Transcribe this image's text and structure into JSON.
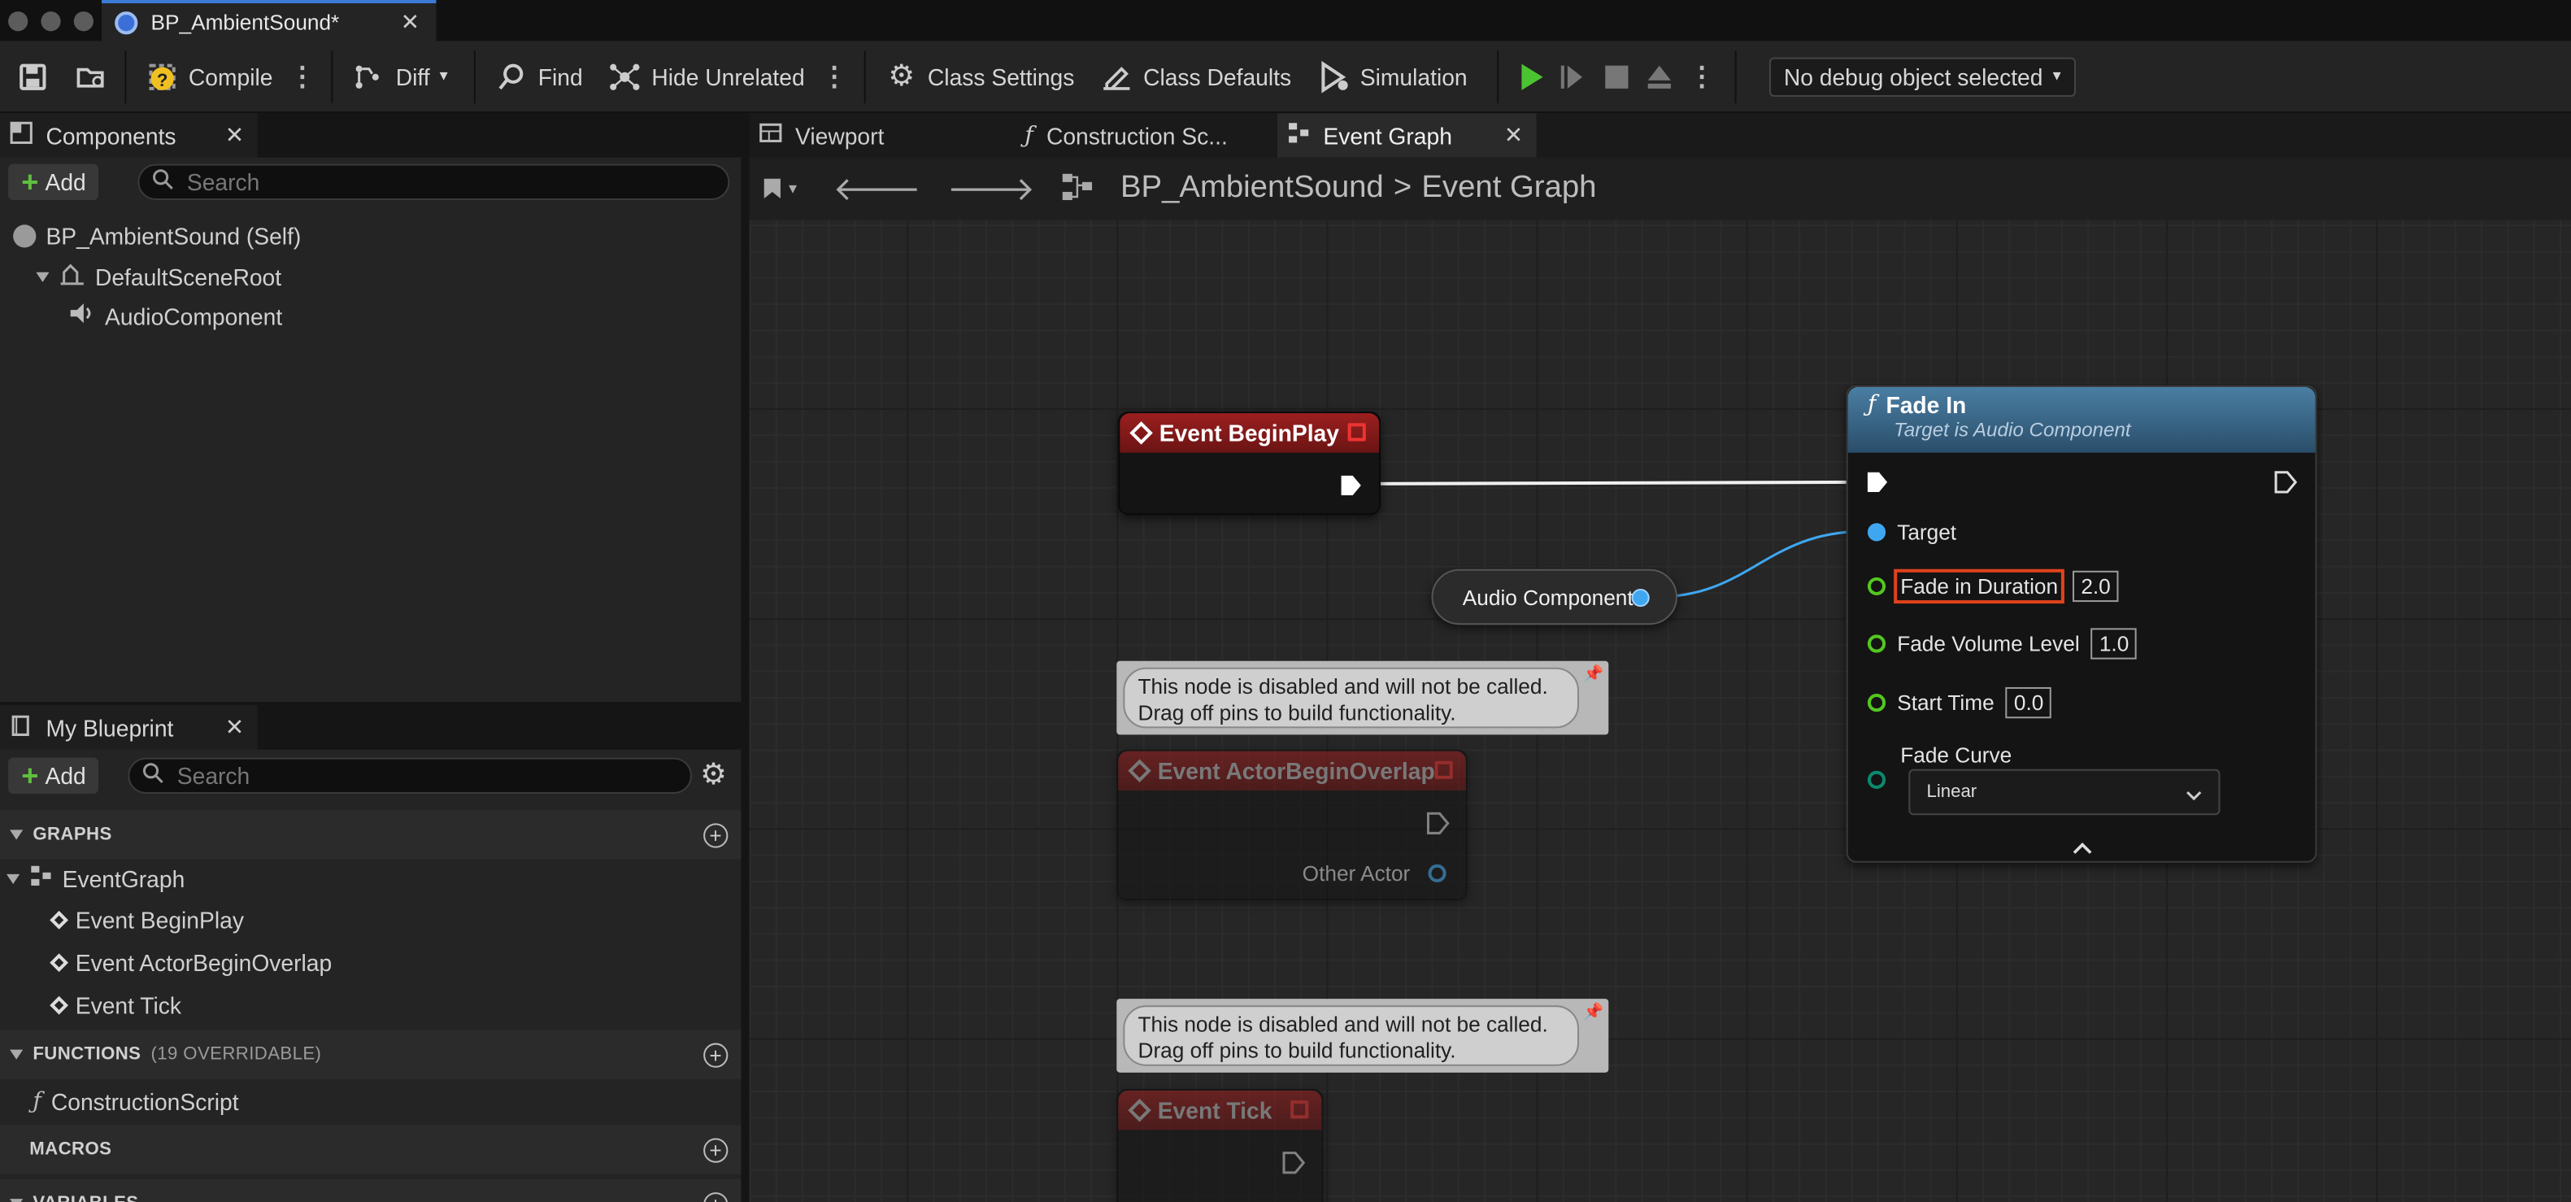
{
  "window": {
    "tab_title": "BP_AmbientSound*"
  },
  "toolbar": {
    "compile": "Compile",
    "diff": "Diff",
    "find": "Find",
    "hide_unrelated": "Hide Unrelated",
    "class_settings": "Class Settings",
    "class_defaults": "Class Defaults",
    "simulation": "Simulation",
    "debug_object": "No debug object selected"
  },
  "components_panel": {
    "tab_label": "Components",
    "add_label": "Add",
    "search_placeholder": "Search",
    "tree": [
      {
        "label": "BP_AmbientSound (Self)"
      },
      {
        "label": "DefaultSceneRoot"
      },
      {
        "label": "AudioComponent"
      }
    ]
  },
  "my_blueprint": {
    "tab_label": "My Blueprint",
    "add_label": "Add",
    "search_placeholder": "Search",
    "graphs_header": "GRAPHS",
    "event_graph": "EventGraph",
    "events": [
      "Event BeginPlay",
      "Event ActorBeginOverlap",
      "Event Tick"
    ],
    "functions_header": "FUNCTIONS",
    "functions_sub": "(19 OVERRIDABLE)",
    "functions": [
      "ConstructionScript"
    ],
    "macros_header": "MACROS",
    "variables_header": "VARIABLES"
  },
  "graph_tabs": [
    {
      "label": "Viewport"
    },
    {
      "label": "Construction Sc..."
    },
    {
      "label": "Event Graph"
    }
  ],
  "breadcrumb": {
    "root": "BP_AmbientSound",
    "separator": ">",
    "current": "Event Graph"
  },
  "nodes": {
    "begin_play": {
      "title": "Event BeginPlay"
    },
    "audio_component": {
      "label": "Audio Component"
    },
    "actor_overlap": {
      "title": "Event ActorBeginOverlap",
      "pin_other_actor": "Other Actor"
    },
    "event_tick": {
      "title": "Event Tick"
    },
    "disabled_comment_1": {
      "line1": "This node is disabled and will not be called.",
      "line2": "Drag off pins to build functionality."
    },
    "disabled_comment_2": {
      "line1": "This node is disabled and will not be called.",
      "line2": "Drag off pins to build functionality."
    },
    "fade_in": {
      "title": "Fade In",
      "subtitle": "Target is Audio Component",
      "target": "Target",
      "fade_in_duration": "Fade in Duration",
      "fade_in_duration_value": "2.0",
      "fade_volume_level": "Fade Volume Level",
      "fade_volume_level_value": "1.0",
      "start_time": "Start Time",
      "start_time_value": "0.0",
      "fade_curve": "Fade Curve",
      "fade_curve_value": "Linear"
    }
  },
  "colors": {
    "event_header": "#8b1a1a",
    "function_header": "#2f5a7a",
    "float_pin": "#53c71f",
    "object_pin": "#3fa7f0",
    "highlight": "#e0421c"
  }
}
